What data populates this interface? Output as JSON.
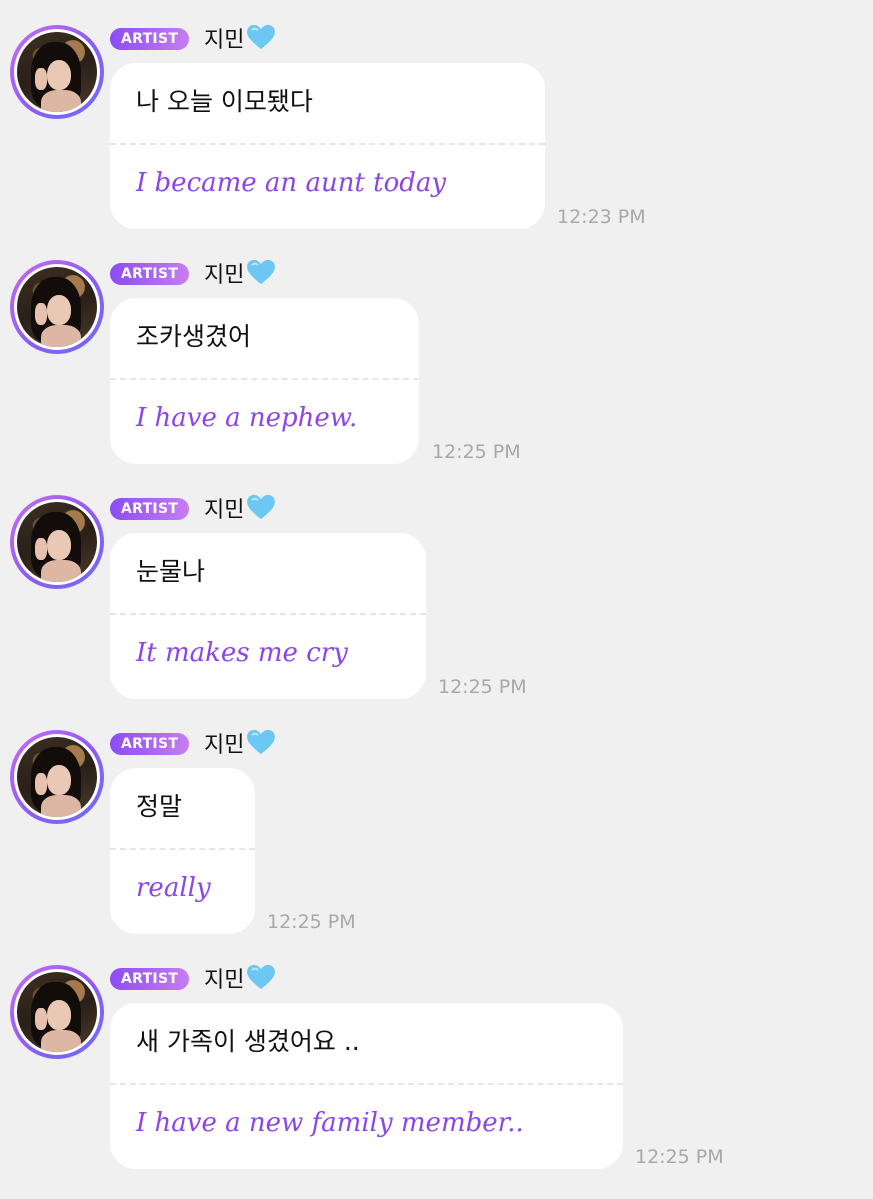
{
  "messages": [
    {
      "badge": "ARTIST",
      "sender": "지민",
      "text": "나 오늘 이모됐다",
      "translation": "I became an aunt today",
      "time": "12:23 PM"
    },
    {
      "badge": "ARTIST",
      "sender": "지민",
      "text": "조카생겼어",
      "translation": "I have a nephew.",
      "time": "12:25 PM"
    },
    {
      "badge": "ARTIST",
      "sender": "지민",
      "text": "눈물나",
      "translation": "It makes me cry",
      "time": "12:25 PM"
    },
    {
      "badge": "ARTIST",
      "sender": "지민",
      "text": "정말",
      "translation": "really",
      "time": "12:25 PM"
    },
    {
      "badge": "ARTIST",
      "sender": "지민",
      "text": "새 가족이 생겼어요 ..",
      "translation": "I have a new family member..",
      "time": "12:25 PM"
    }
  ],
  "colors": {
    "background": "#f0f0f0",
    "badge_gradient": [
      "#8b4cf5",
      "#c77df0"
    ],
    "translation_text": "#8b45e8",
    "timestamp": "#a8a8a8",
    "heart": "#6cc8f3"
  },
  "icons": {
    "sender_suffix": "light-blue-heart-icon",
    "avatar": "artist-avatar"
  }
}
